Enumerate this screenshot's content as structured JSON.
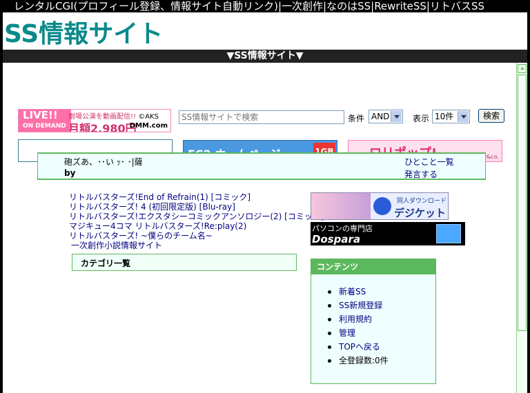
{
  "topbar": {
    "links": [
      "レンタルCGI(プロフィール登録、情報サイト自動リンク)",
      "一次創作",
      "なのはSS",
      "RewriteSS",
      "リトバスSS"
    ],
    "separator": "|"
  },
  "site_title": "SS情報サイト",
  "navbar": {
    "label": "▼SS情報サイト▼"
  },
  "ads": {
    "live": {
      "brand": "LIVE!!",
      "sub": "ON DEMAND",
      "tagline": "劇場公演を動画配信!!",
      "copyright": "©AKS",
      "price": "月額2,980円",
      "provider": "DMM.com"
    },
    "fc2": {
      "text": "FC2 ホームページ",
      "badge": "1GB"
    },
    "loli": {
      "text": "ロリポップ!",
      "sub": "paperboy&co."
    },
    "digiket": {
      "small": "同人ダウンロード",
      "logo": "デジケット"
    },
    "dospara": {
      "top": "パソコンの専門店",
      "brand": "Dospara"
    }
  },
  "search": {
    "placeholder": "SS情報サイトで検索",
    "condition_label": "条件",
    "condition_value": "AND",
    "display_label": "表示",
    "display_value": "10件",
    "button": "検索"
  },
  "hitokoto": {
    "message": "砲ズあ、･･い ｯ･ ･|薩",
    "by": "by",
    "link_list": "ひとこと一覧",
    "link_post": "発言する"
  },
  "items": [
    "リトルバスターズ!End of Refrain(1) [コミック]",
    "リトルバスターズ! 4 (初回限定版) [Blu-ray]",
    "リトルバスターズ!エクスタシーコミックアンソロジー(2) [コミック]",
    "マジキュー4コマ リトルバスターズ!Re:play(2)",
    "リトルバスターズ! ~僕らのチーム名~",
    "一次創作小説情報サイト"
  ],
  "category": {
    "title": "カテゴリ一覧"
  },
  "contents": {
    "title": "コンテンツ",
    "items": [
      "新着SS",
      "SS新規登録",
      "利用規約",
      "管理",
      "TOPへ戻る",
      "全登録数:0件"
    ]
  }
}
